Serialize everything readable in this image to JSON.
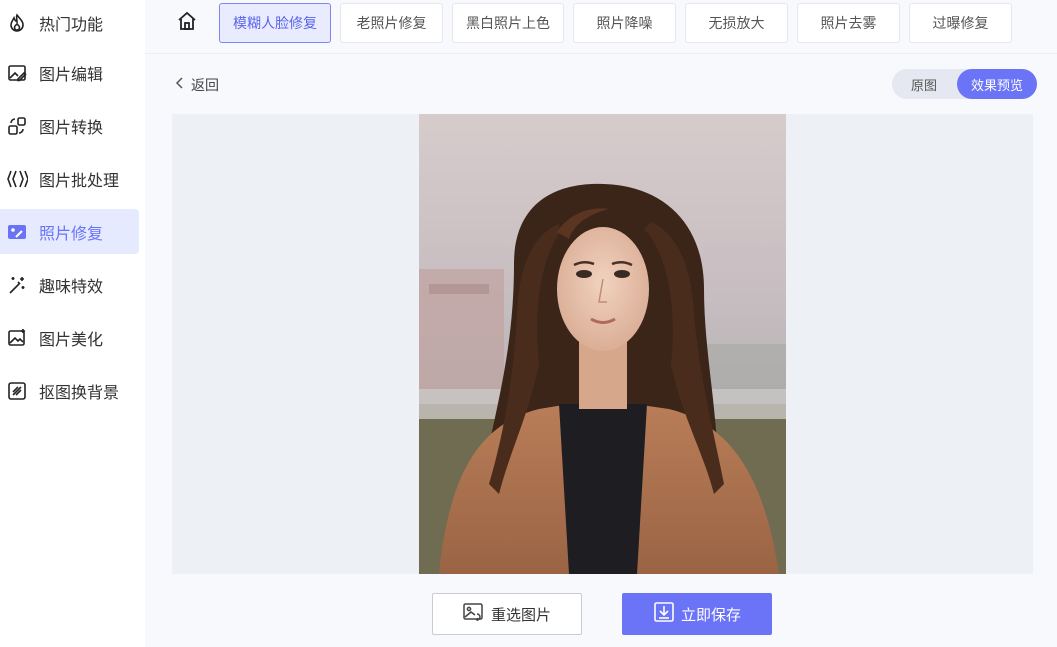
{
  "sidebar": {
    "items": [
      {
        "label": "热门功能",
        "icon": "flame-icon"
      },
      {
        "label": "图片编辑",
        "icon": "image-edit-icon"
      },
      {
        "label": "图片转换",
        "icon": "convert-icon"
      },
      {
        "label": "图片批处理",
        "icon": "batch-icon"
      },
      {
        "label": "照片修复",
        "icon": "photo-repair-icon",
        "active": true
      },
      {
        "label": "趣味特效",
        "icon": "magic-wand-icon"
      },
      {
        "label": "图片美化",
        "icon": "image-beautify-icon"
      },
      {
        "label": "抠图换背景",
        "icon": "cutout-icon"
      }
    ]
  },
  "topbar": {
    "tabs": [
      {
        "label": "模糊人脸修复",
        "active": true
      },
      {
        "label": "老照片修复"
      },
      {
        "label": "黑白照片上色"
      },
      {
        "label": "照片降噪"
      },
      {
        "label": "无损放大"
      },
      {
        "label": "照片去雾"
      },
      {
        "label": "过曝修复"
      }
    ]
  },
  "back_label": "返回",
  "view_toggle": {
    "original": "原图",
    "preview": "效果预览",
    "selected": "preview"
  },
  "actions": {
    "reselect": "重选图片",
    "save": "立即保存"
  },
  "colors": {
    "accent": "#6b74f6",
    "active_bg": "#e9ecff"
  }
}
